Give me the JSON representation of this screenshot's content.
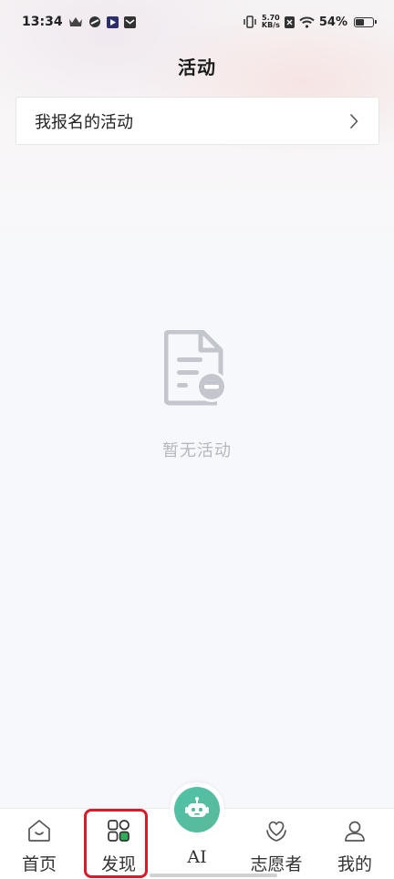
{
  "status_bar": {
    "time": "13:34",
    "net_speed_value": "5.70",
    "net_speed_unit": "KB/s",
    "battery_percent": "54%",
    "battery_level": 0.54
  },
  "header": {
    "title": "活动"
  },
  "card": {
    "label": "我报名的活动"
  },
  "empty_state": {
    "text": "暂无活动"
  },
  "tabbar": {
    "tabs": [
      {
        "label": "首页",
        "icon": "home-icon"
      },
      {
        "label": "发现",
        "icon": "grid-icon"
      },
      {
        "label": "AI",
        "icon": "robot-icon"
      },
      {
        "label": "志愿者",
        "icon": "heart-hand-icon"
      },
      {
        "label": "我的",
        "icon": "user-icon"
      }
    ],
    "active_tab": "发现"
  },
  "colors": {
    "ai_button": "#4fc3a8",
    "highlight": "#d41c2a",
    "empty_icon": "#c3c6cd",
    "active_accent": "#2fae5a"
  }
}
